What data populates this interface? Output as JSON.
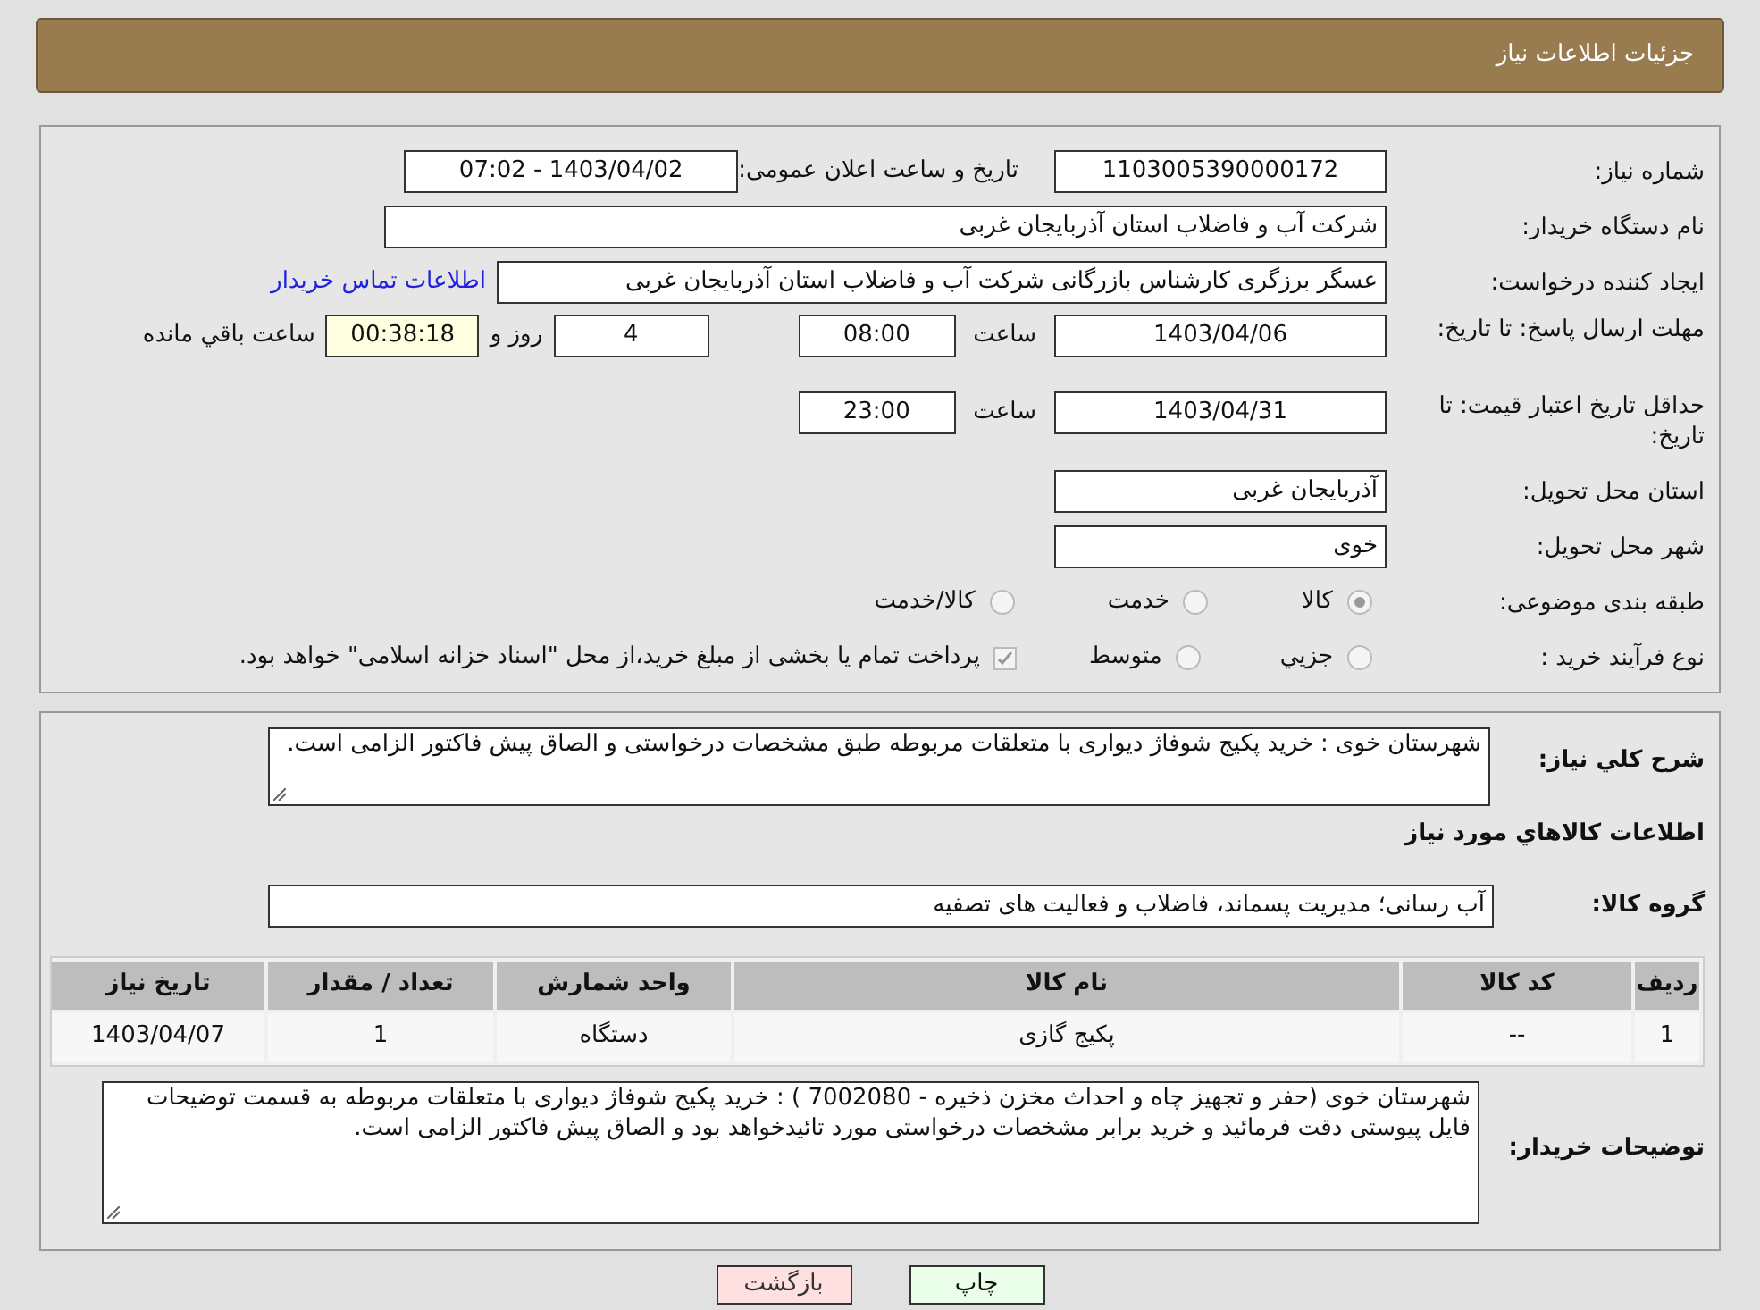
{
  "header": {
    "title": "جزئیات اطلاعات نیاز"
  },
  "need_number": {
    "label": "شماره نیاز:",
    "value": "1103005390000172"
  },
  "announce": {
    "label": "تاریخ و ساعت اعلان عمومی:",
    "value": "1403/04/02 - 07:02"
  },
  "buyer_org": {
    "label": "نام دستگاه خریدار:",
    "value": "شرکت آب و فاضلاب استان آذربایجان غربی"
  },
  "requester": {
    "label": "ایجاد کننده درخواست:",
    "value": "عسگر  برزگری کارشناس بازرگانی شرکت آب و فاضلاب استان آذربایجان غربی",
    "link": "اطلاعات تماس خریدار"
  },
  "deadline": {
    "label": "مهلت ارسال پاسخ: تا تاریخ:",
    "date": "1403/04/06",
    "time_label": "ساعت",
    "time": "08:00",
    "days": "4",
    "days_label": "روز و",
    "remaining": "00:38:18",
    "remaining_label": "ساعت باقي مانده"
  },
  "validity": {
    "label": "حداقل تاریخ اعتبار قیمت: تا تاریخ:",
    "date": "1403/04/31",
    "time_label": "ساعت",
    "time": "23:00"
  },
  "province": {
    "label": "استان محل تحویل:",
    "value": "آذربایجان غربی"
  },
  "city": {
    "label": "شهر محل تحویل:",
    "value": "خوی"
  },
  "category": {
    "label": "طبقه بندی موضوعی:",
    "options": [
      {
        "label": "کالا",
        "selected": true
      },
      {
        "label": "خدمت",
        "selected": false
      },
      {
        "label": "کالا/خدمت",
        "selected": false
      }
    ]
  },
  "purchase_type": {
    "label": "نوع فرآیند خرید :",
    "options": [
      {
        "label": "جزيي",
        "selected": false
      },
      {
        "label": "متوسط",
        "selected": false
      }
    ],
    "payment": {
      "label": "پرداخت تمام یا بخشی از مبلغ خرید،از محل \"اسناد خزانه اسلامی\" خواهد بود.",
      "checked": true
    }
  },
  "summary": {
    "label": "شرح کلي نیاز:",
    "value": "شهرستان خوی : خرید  پکیج شوفاژ دیواری با متعلقات مربوطه  طبق مشخصات درخواستی و الصاق پیش فاکتور الزامی است."
  },
  "goods_title": "اطلاعات کالاهاي مورد نیاز",
  "goods_group": {
    "label": "گروه کالا:",
    "value": "آب رسانی؛ مدیریت پسماند، فاضلاب و فعالیت های تصفیه"
  },
  "table": {
    "columns": [
      "ردیف",
      "کد کالا",
      "نام کالا",
      "واحد شمارش",
      "تعداد / مقدار",
      "تاریخ نیاز"
    ],
    "rows": [
      [
        "1",
        "--",
        "پکیج گازی",
        "دستگاه",
        "1",
        "1403/04/07"
      ]
    ]
  },
  "buyer_notes": {
    "label": "توضیحات خریدار:",
    "value": "شهرستان خوی (حفر و تجهیز چاه و احداث مخزن ذخیره - 7002080 ) : خرید  پکیج شوفاژ دیواری با متعلقات مربوطه به قسمت توضیحات فایل پیوستی دقت فرمائید و  خرید برابر مشخصات درخواستی مورد تائیدخواهد بود  و الصاق پیش فاکتور الزامی است."
  },
  "buttons": [
    {
      "kind": "print",
      "label": "چاپ"
    },
    {
      "kind": "back",
      "label": "بازگشت"
    }
  ]
}
